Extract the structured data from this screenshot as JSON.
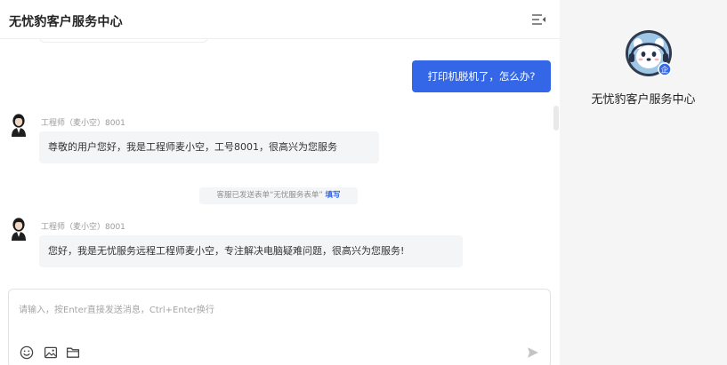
{
  "header": {
    "title": "无忧豹客户服务中心",
    "menu_icon": "menu-collapse-icon"
  },
  "messages": {
    "user_message": "打印机脱机了，怎么办?",
    "agent_1": {
      "name": "工程师（麦小空）8001",
      "text": "尊敬的用户您好，我是工程师麦小空，工号8001，很高兴为您服务"
    },
    "system_notice": {
      "text": "客服已发送表单“无忧服务表单”",
      "link": "填写"
    },
    "agent_2": {
      "name": "工程师（麦小空）8001",
      "text": "您好，我是无忧服务远程工程师麦小空，专注解决电脑疑难问题，很高兴为您服务!"
    }
  },
  "input": {
    "placeholder": "请输入，按Enter直接发送消息，Ctrl+Enter换行",
    "value": "",
    "tools": [
      "emoji-icon",
      "image-icon",
      "folder-icon"
    ],
    "send_icon": "send-icon"
  },
  "side_panel": {
    "brand_name": "无忧豹客户服务中心",
    "badge_text": "企"
  },
  "colors": {
    "accent": "#3467e8",
    "agent_bubble": "#f4f5f7",
    "side_bg": "#f5f5f5",
    "badge": "#3467e8"
  }
}
